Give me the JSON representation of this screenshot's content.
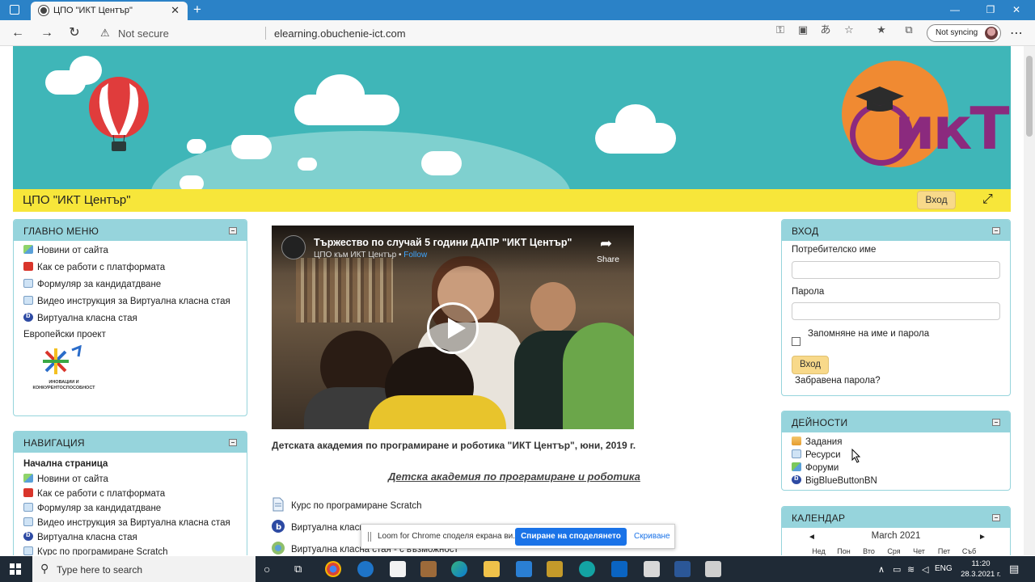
{
  "browser": {
    "tab_title": "ЦПО \"ИКТ Център\"",
    "not_secure": "Not secure",
    "url": "elearning.obuchenie-ict.com",
    "sync_label": "Not syncing"
  },
  "header": {
    "site_title": "ЦПО \"ИКТ Център\"",
    "login_label": "Вход"
  },
  "main_menu": {
    "title": "ГЛАВНО МЕНЮ",
    "items": [
      {
        "label": "Новини от сайта",
        "icon": "news-icon"
      },
      {
        "label": "Как се работи с платформата",
        "icon": "pdf-icon"
      },
      {
        "label": "Формуляр за кандидатдване",
        "icon": "resource-icon"
      },
      {
        "label": "Видео инструкция за Виртуална класна стая",
        "icon": "resource-icon"
      },
      {
        "label": "Виртуална класна стая",
        "icon": "bigbluebutton-icon"
      }
    ],
    "euro_label": "Европейски проект",
    "euro_logo_text": "ИНОВАЦИИ И КОНКУРЕНТОСПОСОБНОСТ"
  },
  "navigation": {
    "title": "НАВИГАЦИЯ",
    "home": "Начална страница",
    "items": [
      {
        "label": "Новини от сайта",
        "icon": "news-icon"
      },
      {
        "label": "Как се работи с платформата",
        "icon": "pdf-icon"
      },
      {
        "label": "Формуляр за кандидатдване",
        "icon": "resource-icon"
      },
      {
        "label": "Видео инструкция за Виртуална класна стая",
        "icon": "resource-icon"
      },
      {
        "label": "Виртуална класна стая",
        "icon": "bigbluebutton-icon"
      },
      {
        "label": "Курс по програмиране Scratch",
        "icon": "resource-icon"
      }
    ]
  },
  "video": {
    "title": "Тържество по случай 5 години ДАПР \"ИКТ Център\"",
    "channel": "ЦПО към ИКТ Център",
    "follow": "Follow",
    "share": "Share"
  },
  "content": {
    "caption": "Детската академия по програмиране и роботика \"ИКТ Център\", юни, 2019 г.",
    "course_link": "Детска академия по програмиране и роботика",
    "activities": [
      {
        "label": "Курс по програмиране Scratch",
        "icon": "page-icon"
      },
      {
        "label": "Виртуална класна стая",
        "icon": "bigbluebutton-icon"
      },
      {
        "label": "Виртуална класна стая - с възможност",
        "icon": "bigbluebutton-icon"
      }
    ]
  },
  "loom_bar": {
    "message": "Loom for Chrome споделя екрана ви.",
    "stop_label": "Спиране на споделянето",
    "hide_label": "Скриване"
  },
  "login_block": {
    "title": "ВХОД",
    "username_label": "Потребителско име",
    "password_label": "Парола",
    "remember_label": "Запомняне на име и парола",
    "login_button": "Вход",
    "forgot_link": "Забравена парола?"
  },
  "activities_block": {
    "title": "ДЕЙНОСТИ",
    "items": [
      {
        "label": "Задания",
        "icon": "assignment-icon"
      },
      {
        "label": "Ресурси",
        "icon": "resource-icon"
      },
      {
        "label": "Форуми",
        "icon": "forum-icon"
      },
      {
        "label": "BigBlueButtonBN",
        "icon": "bigbluebutton-icon"
      }
    ]
  },
  "calendar_block": {
    "title": "КАЛЕНДАР",
    "month": "March 2021",
    "prev": "◄",
    "next": "►",
    "days": [
      "Нед",
      "Пон",
      "Вто",
      "Сря",
      "Чет",
      "Пет",
      "Съб"
    ]
  },
  "taskbar": {
    "search_placeholder": "Type here to search",
    "lang": "ENG",
    "time": "11:20",
    "date": "28.3.2021 г."
  }
}
